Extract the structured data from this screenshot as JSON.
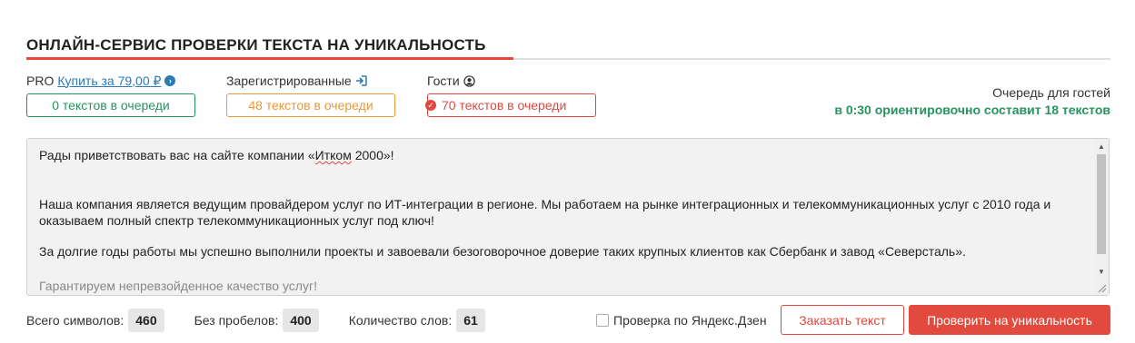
{
  "header": {
    "title": "ОНЛАЙН-СЕРВИС ПРОВЕРКИ ТЕКСТА НА УНИКАЛЬНОСТЬ"
  },
  "tiers": {
    "pro": {
      "label": "PRO",
      "link": "Купить за 79,00 ₽",
      "queue": "0 текстов в очереди",
      "icon": "chevron-right-circle-icon"
    },
    "registered": {
      "label": "Зарегистрированные",
      "queue": "48 текстов в очереди",
      "icon": "sign-in-icon"
    },
    "guests": {
      "label": "Гости",
      "queue": "70 текстов в очереди",
      "icon": "user-circle-icon",
      "status_icon": "check-circle-icon"
    }
  },
  "guest_queue": {
    "line1": "Очередь для гостей",
    "line2": "в 0:30 ориентировочно составит 18 текстов"
  },
  "editor": {
    "p1_before": "Рады приветствовать вас на сайте компании «",
    "p1_misspelled": "Итком",
    "p1_after": " 2000»!",
    "p2": "Наша компания является ведущим провайдером услуг по ИТ-интеграции в регионе. Мы работаем на рынке интеграционных и телекоммуникационных услуг с 2010 года и оказываем полный спектр телекоммуникационных услуг под ключ!",
    "p3": "За долгие годы работы мы успешно выполнили проекты и завоевали безоговорочное доверие таких крупных клиентов как Сбербанк и завод «Северсталь».",
    "p4_partial": "Гарантируем непревзойденное качество услуг!"
  },
  "stats": {
    "chars_label": "Всего символов:",
    "chars_value": "460",
    "nospace_label": "Без пробелов:",
    "nospace_value": "400",
    "words_label": "Количество слов:",
    "words_value": "61"
  },
  "options": {
    "dzen_label": "Проверка по Яндекс.Дзен"
  },
  "buttons": {
    "order": "Заказать текст",
    "check": "Проверить на уникальность"
  },
  "colors": {
    "accent": "#e24a3d",
    "green": "#27935f",
    "orange": "#e8993a",
    "link": "#2a7ab5"
  }
}
